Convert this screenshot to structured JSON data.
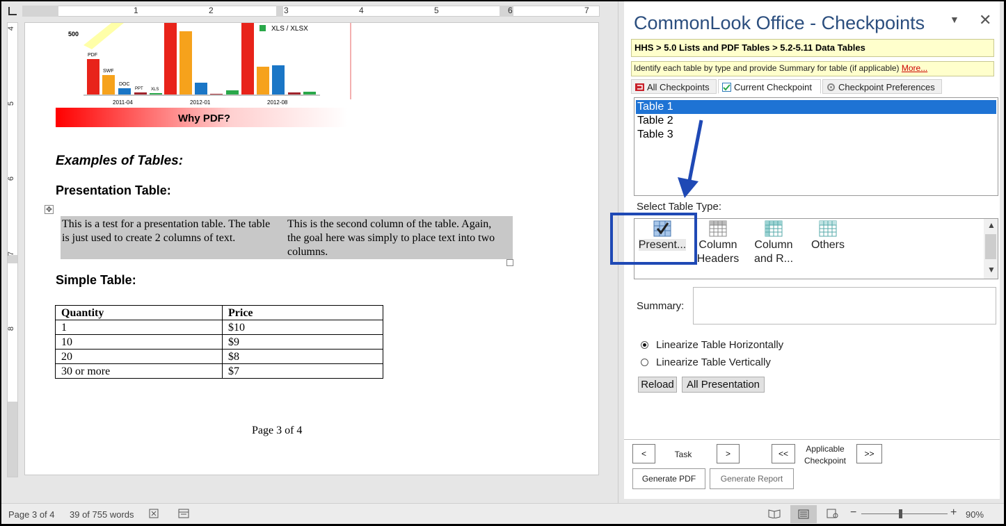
{
  "ruler": {
    "numbers": [
      "1",
      "2",
      "3",
      "4",
      "5",
      "6",
      "7"
    ],
    "vnumbers": [
      "4",
      "5",
      "6",
      "7",
      "8"
    ]
  },
  "document": {
    "chart": {
      "value_label": "500",
      "bars_labels": [
        "PDF",
        "SWF",
        "DOC",
        "PPT",
        "XLS"
      ],
      "legend": "XLS / XLSX",
      "xticks": [
        "2011-04",
        "2012-01",
        "2012-08"
      ],
      "title": "Why PDF?"
    },
    "heading_examples": "Examples of Tables:",
    "heading_presentation": "Presentation Table:",
    "pres_col1": "This is a test for a presentation table. The table is just used to create 2 columns of text.",
    "pres_col2": "This is the second column of the table. Again, the goal here was simply to place text into two columns.",
    "heading_simple": "Simple Table:",
    "simple_table": {
      "headers": [
        "Quantity",
        "Price"
      ],
      "rows": [
        [
          "1",
          "$10"
        ],
        [
          "10",
          "$9"
        ],
        [
          "20",
          "$8"
        ],
        [
          "30 or more",
          "$7"
        ]
      ]
    },
    "page_footer": "Page 3 of 4"
  },
  "statusbar": {
    "page": "Page 3 of 4",
    "words": "39 of 755 words",
    "zoom": "90%"
  },
  "pane": {
    "title": "CommonLook Office - Checkpoints",
    "dropdown_icon": "▼",
    "close_icon": "✕",
    "breadcrumb": "HHS > 5.0 Lists and PDF Tables > 5.2-5.11 Data Tables",
    "description": "Identify each table by type and provide Summary for table (if applicable)",
    "more_link": "More...",
    "tabs": [
      "All Checkpoints",
      "Current Checkpoint",
      "Checkpoint Preferences"
    ],
    "tables": [
      "Table 1",
      "Table 2",
      "Table 3"
    ],
    "select_label": "Select Table Type:",
    "types": [
      "Present...",
      "Column Headers",
      "Column and R...",
      "Others"
    ],
    "summary_label": "Summary:",
    "radio_h": "Linearize Table Horizontally",
    "radio_v": "Linearize Table Vertically",
    "reload": "Reload",
    "all_presentation": "All Presentation",
    "prev": "<",
    "task": "Task",
    "next": ">",
    "prev_app": "<<",
    "applicable": "Applicable Checkpoint",
    "next_app": ">>",
    "generate_pdf": "Generate PDF",
    "generate_report": "Generate Report"
  }
}
